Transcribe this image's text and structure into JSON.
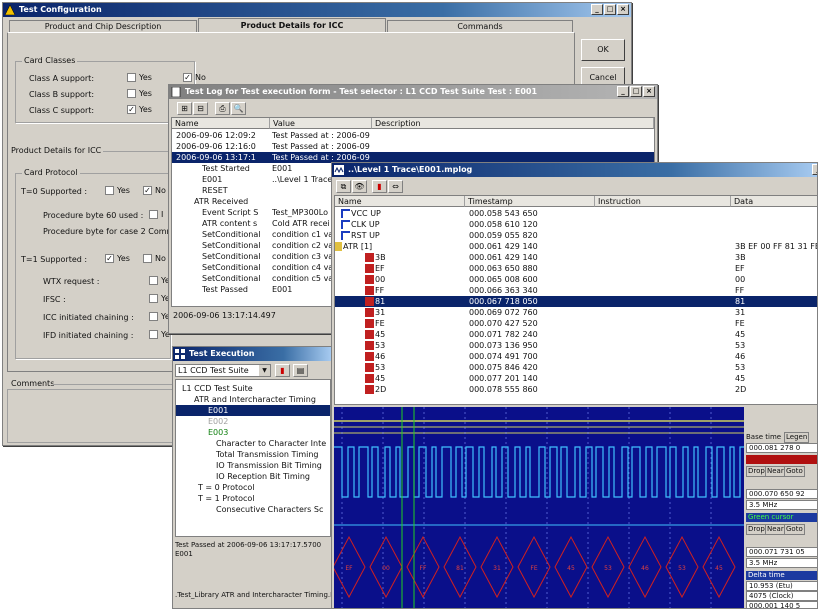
{
  "config": {
    "title": "Test Configuration",
    "tabs": [
      "Product and Chip Description",
      "Product Details for ICC",
      "Commands"
    ],
    "ok": "OK",
    "cancel": "Cancel",
    "card_classes": "Card Classes",
    "class_a": "Class A support:",
    "class_b": "Class B support:",
    "class_c": "Class C support:",
    "yes": "Yes",
    "no": "No",
    "product_details": "Product Details for ICC",
    "card_protocol": "Card Protocol",
    "t0": "T=0 Supported :",
    "proc60": "Procedure byte 60 used :",
    "proc_case2": "Procedure byte for case 2 Comm",
    "t1": "T=1 Supported :",
    "wtx": "WTX request :",
    "ifsc": "IFSC :",
    "icc_chain": "ICC initiated chaining :",
    "ifd_chain": "IFD initiated chaining :",
    "comments": "Comments",
    "check": "✓",
    "ye_short": "Ye",
    "i_short": "I"
  },
  "log": {
    "title": "Test Log for Test execution form - Test selector : L1 CCD Test Suite     Test : E001",
    "cols": [
      "Name",
      "Value",
      "Description"
    ],
    "rows": [
      {
        "n": "2006-09-06 12:09:2",
        "v": "Test Passed at : 2006-09-06"
      },
      {
        "n": "2006-09-06 12:16:0",
        "v": "Test Passed at : 2006-09-06"
      },
      {
        "n": "2006-09-06 13:17:1",
        "v": "Test Passed at : 2006-09-06"
      },
      {
        "n": "Test Started",
        "v": "E001"
      },
      {
        "n": "E001",
        "v": "..\\Level 1 Trace"
      },
      {
        "n": "RESET",
        "v": ""
      },
      {
        "n": "ATR Received",
        "v": ""
      },
      {
        "n": "Event Script S",
        "v": "Test_MP300Lo"
      },
      {
        "n": "ATR content s",
        "v": "Cold ATR recei"
      },
      {
        "n": "SetConditional",
        "v": "condition c1 va"
      },
      {
        "n": "SetConditional",
        "v": "condition c2 va"
      },
      {
        "n": "SetConditional",
        "v": "condition c3 va"
      },
      {
        "n": "SetConditional",
        "v": "condition c4 va"
      },
      {
        "n": "SetConditional",
        "v": "condition c5 va"
      },
      {
        "n": "Test Passed",
        "v": "E001"
      }
    ],
    "status": "2006-09-06 13:17:14.497"
  },
  "exec": {
    "title": "Test Execution",
    "select": "L1 CCD Test Suite",
    "tree": [
      "L1 CCD Test Suite",
      "ATR and Intercharacter Timing",
      "E001",
      "E002",
      "E003",
      "Character to Character Inte",
      "Total Transmission Timing",
      "IO Transmission Bit Timing",
      "IO Reception Bit Timing",
      "T = 0 Protocol",
      "T = 1 Protocol",
      "Consecutive Characters Sc"
    ],
    "result_line1": "Test Passed at 2006-09-06 13:17:17.5700",
    "result_line2": "E001",
    "footer": ".Test_Library ATR and Intercharacter Timing.E"
  },
  "trace": {
    "title": "..\\Level 1 Trace\\E001.mplog",
    "cols": [
      "Name",
      "Timestamp",
      "Instruction",
      "Data"
    ],
    "rows": [
      {
        "n": "VCC UP",
        "t": "000.058 543 650",
        "d": ""
      },
      {
        "n": "CLK UP",
        "t": "000.058 610 120",
        "d": ""
      },
      {
        "n": "RST UP",
        "t": "000.059 055 820",
        "d": ""
      },
      {
        "n": "ATR [1]",
        "t": "000.061 429 140",
        "d": "3B EF 00 FF 81 31 FE 45"
      },
      {
        "n": "3B",
        "t": "000.061 429 140",
        "d": "3B"
      },
      {
        "n": "EF",
        "t": "000.063 650 880",
        "d": "EF"
      },
      {
        "n": "00",
        "t": "000.065 008 600",
        "d": "00"
      },
      {
        "n": "FF",
        "t": "000.066 363 340",
        "d": "FF"
      },
      {
        "n": "81",
        "t": "000.067 718 050",
        "d": "81"
      },
      {
        "n": "31",
        "t": "000.069 072 760",
        "d": "31"
      },
      {
        "n": "FE",
        "t": "000.070 427 520",
        "d": "FE"
      },
      {
        "n": "45",
        "t": "000.071 782 240",
        "d": "45"
      },
      {
        "n": "53",
        "t": "000.073 136 950",
        "d": "53"
      },
      {
        "n": "46",
        "t": "000.074 491 700",
        "d": "46"
      },
      {
        "n": "53",
        "t": "000.075 846 420",
        "d": "53"
      },
      {
        "n": "45",
        "t": "000.077 201 140",
        "d": "45"
      },
      {
        "n": "2D",
        "t": "000.078 555 860",
        "d": "2D"
      }
    ],
    "side": {
      "base_time": "Base time",
      "legend": "Legen",
      "base_val": "000.081 278 0",
      "drop": "Drop",
      "near": "Near",
      "goto": "Goto",
      "c1_val": "000.070 650 92",
      "c1_freq": "3.5 MHz",
      "green_cursor": "Green cursor",
      "c2_val": "000.071 731 05",
      "c2_freq": "3.5 MHz",
      "delta": "Delta time",
      "d1": "10.953 (Etu)",
      "d2": "4075 (Clock)",
      "d3": "000.001 140 5"
    },
    "wave_labels": [
      "EF",
      "00",
      "FF",
      "81",
      "31",
      "FE",
      "45",
      "53",
      "46",
      "53",
      "45"
    ]
  }
}
